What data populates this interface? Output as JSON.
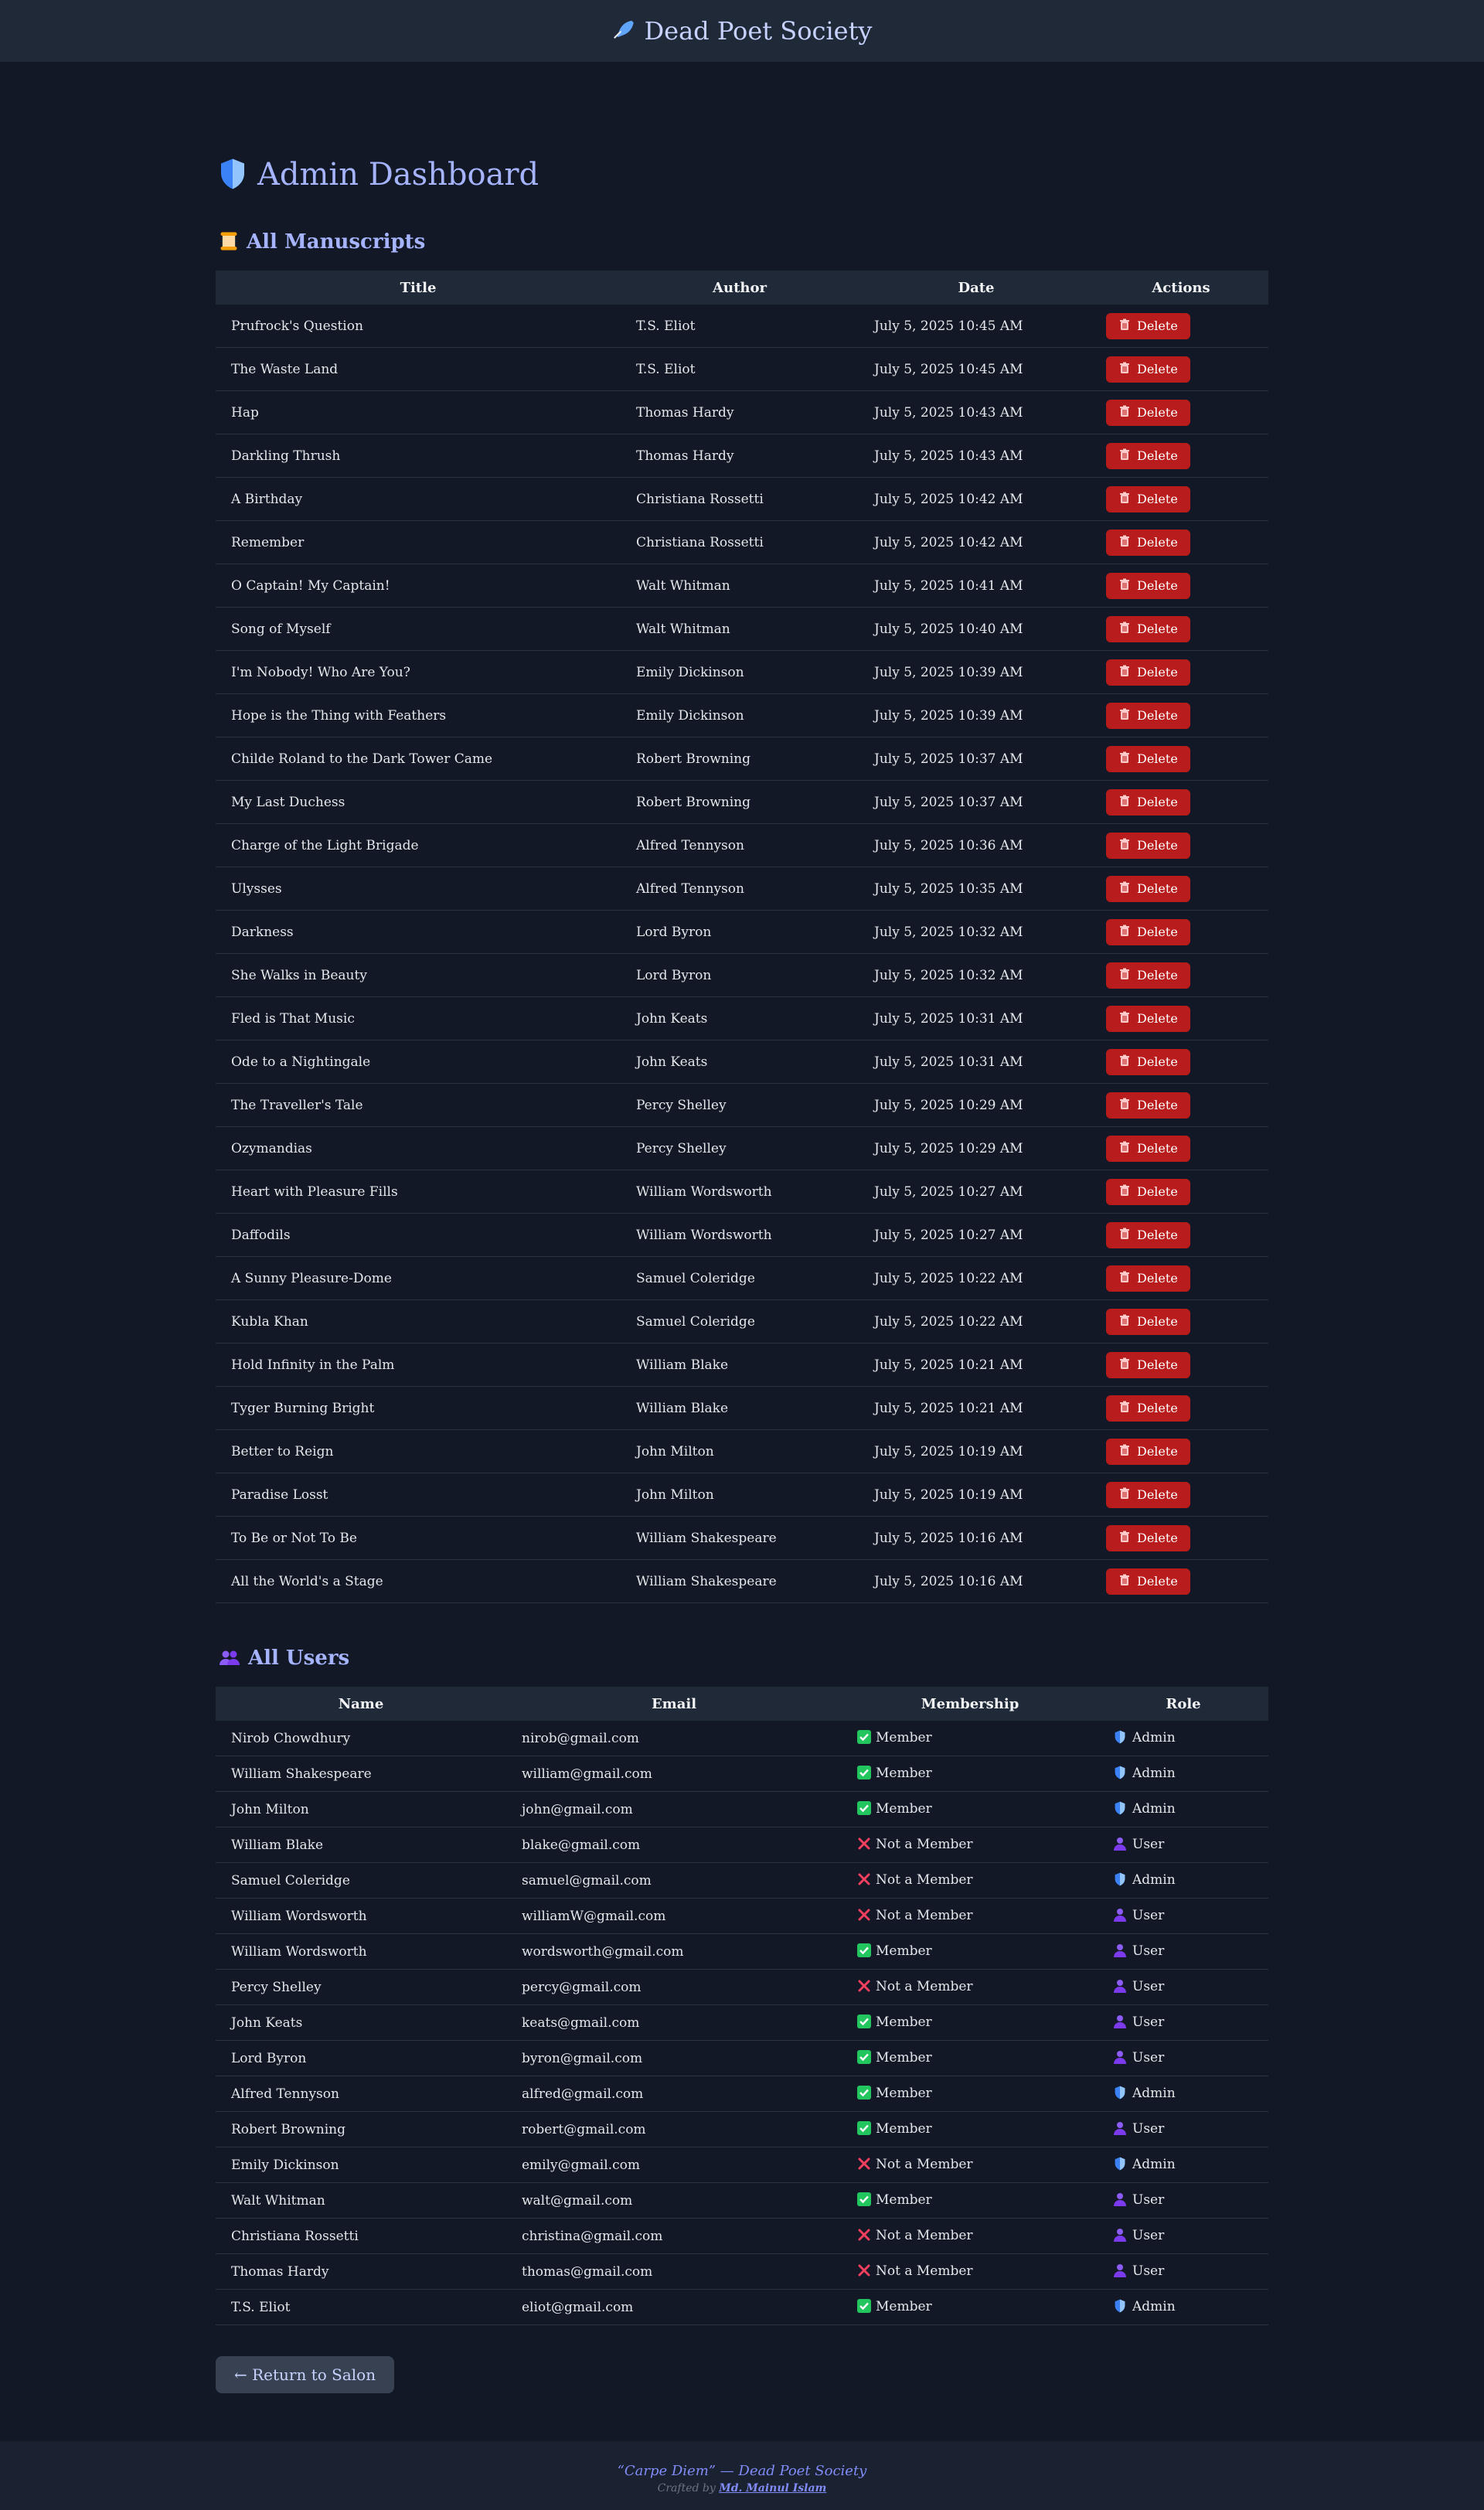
{
  "header": {
    "icon": "quill-icon",
    "site_title": "Dead Poet Society"
  },
  "page": {
    "icon": "shield-icon",
    "title": "Admin Dashboard"
  },
  "manuscripts": {
    "section_icon": "scroll-icon",
    "section_title": "All Manuscripts",
    "columns": [
      "Title",
      "Author",
      "Date",
      "Actions"
    ],
    "delete_label": "Delete",
    "rows": [
      {
        "title": "Prufrock's Question",
        "author": "T.S. Eliot",
        "date": "July 5, 2025 10:45 AM"
      },
      {
        "title": "The Waste Land",
        "author": "T.S. Eliot",
        "date": "July 5, 2025 10:45 AM"
      },
      {
        "title": "Hap",
        "author": "Thomas Hardy",
        "date": "July 5, 2025 10:43 AM"
      },
      {
        "title": "Darkling Thrush",
        "author": "Thomas Hardy",
        "date": "July 5, 2025 10:43 AM"
      },
      {
        "title": "A Birthday",
        "author": "Christiana Rossetti",
        "date": "July 5, 2025 10:42 AM"
      },
      {
        "title": "Remember",
        "author": "Christiana Rossetti",
        "date": "July 5, 2025 10:42 AM"
      },
      {
        "title": "O Captain! My Captain!",
        "author": "Walt Whitman",
        "date": "July 5, 2025 10:41 AM"
      },
      {
        "title": "Song of Myself",
        "author": "Walt Whitman",
        "date": "July 5, 2025 10:40 AM"
      },
      {
        "title": "I'm Nobody! Who Are You?",
        "author": "Emily Dickinson",
        "date": "July 5, 2025 10:39 AM"
      },
      {
        "title": "Hope is the Thing with Feathers",
        "author": "Emily Dickinson",
        "date": "July 5, 2025 10:39 AM"
      },
      {
        "title": "Childe Roland to the Dark Tower Came",
        "author": "Robert Browning",
        "date": "July 5, 2025 10:37 AM"
      },
      {
        "title": "My Last Duchess",
        "author": "Robert Browning",
        "date": "July 5, 2025 10:37 AM"
      },
      {
        "title": "Charge of the Light Brigade",
        "author": "Alfred Tennyson",
        "date": "July 5, 2025 10:36 AM"
      },
      {
        "title": "Ulysses",
        "author": "Alfred Tennyson",
        "date": "July 5, 2025 10:35 AM"
      },
      {
        "title": "Darkness",
        "author": "Lord Byron",
        "date": "July 5, 2025 10:32 AM"
      },
      {
        "title": "She Walks in Beauty",
        "author": "Lord Byron",
        "date": "July 5, 2025 10:32 AM"
      },
      {
        "title": "Fled is That Music",
        "author": "John Keats",
        "date": "July 5, 2025 10:31 AM"
      },
      {
        "title": "Ode to a Nightingale",
        "author": "John Keats",
        "date": "July 5, 2025 10:31 AM"
      },
      {
        "title": "The Traveller's Tale",
        "author": "Percy Shelley",
        "date": "July 5, 2025 10:29 AM"
      },
      {
        "title": "Ozymandias",
        "author": "Percy Shelley",
        "date": "July 5, 2025 10:29 AM"
      },
      {
        "title": "Heart with Pleasure Fills",
        "author": "William Wordsworth",
        "date": "July 5, 2025 10:27 AM"
      },
      {
        "title": "Daffodils",
        "author": "William Wordsworth",
        "date": "July 5, 2025 10:27 AM"
      },
      {
        "title": "A Sunny Pleasure-Dome",
        "author": "Samuel Coleridge",
        "date": "July 5, 2025 10:22 AM"
      },
      {
        "title": "Kubla Khan",
        "author": "Samuel Coleridge",
        "date": "July 5, 2025 10:22 AM"
      },
      {
        "title": "Hold Infinity in the Palm",
        "author": "William Blake",
        "date": "July 5, 2025 10:21 AM"
      },
      {
        "title": "Tyger Burning Bright",
        "author": "William Blake",
        "date": "July 5, 2025 10:21 AM"
      },
      {
        "title": "Better to Reign",
        "author": "John Milton",
        "date": "July 5, 2025 10:19 AM"
      },
      {
        "title": "Paradise Losst",
        "author": "John Milton",
        "date": "July 5, 2025 10:19 AM"
      },
      {
        "title": "To Be or Not To Be",
        "author": "William Shakespeare",
        "date": "July 5, 2025 10:16 AM"
      },
      {
        "title": "All the World's a Stage",
        "author": "William Shakespeare",
        "date": "July 5, 2025 10:16 AM"
      }
    ]
  },
  "users": {
    "section_icon": "users-icon",
    "section_title": "All Users",
    "columns": [
      "Name",
      "Email",
      "Membership",
      "Role"
    ],
    "rows": [
      {
        "name": "Nirob Chowdhury",
        "email": "nirob@gmail.com",
        "membership": "Member",
        "member": true,
        "role": "Admin"
      },
      {
        "name": "William Shakespeare",
        "email": "william@gmail.com",
        "membership": "Member",
        "member": true,
        "role": "Admin"
      },
      {
        "name": "John Milton",
        "email": "john@gmail.com",
        "membership": "Member",
        "member": true,
        "role": "Admin"
      },
      {
        "name": "William Blake",
        "email": "blake@gmail.com",
        "membership": "Not a Member",
        "member": false,
        "role": "User"
      },
      {
        "name": "Samuel Coleridge",
        "email": "samuel@gmail.com",
        "membership": "Not a Member",
        "member": false,
        "role": "Admin"
      },
      {
        "name": "William Wordsworth",
        "email": "williamW@gmail.com",
        "membership": "Not a Member",
        "member": false,
        "role": "User"
      },
      {
        "name": "William Wordsworth",
        "email": "wordsworth@gmail.com",
        "membership": "Member",
        "member": true,
        "role": "User"
      },
      {
        "name": "Percy Shelley",
        "email": "percy@gmail.com",
        "membership": "Not a Member",
        "member": false,
        "role": "User"
      },
      {
        "name": "John Keats",
        "email": "keats@gmail.com",
        "membership": "Member",
        "member": true,
        "role": "User"
      },
      {
        "name": "Lord Byron",
        "email": "byron@gmail.com",
        "membership": "Member",
        "member": true,
        "role": "User"
      },
      {
        "name": "Alfred Tennyson",
        "email": "alfred@gmail.com",
        "membership": "Member",
        "member": true,
        "role": "Admin"
      },
      {
        "name": "Robert Browning",
        "email": "robert@gmail.com",
        "membership": "Member",
        "member": true,
        "role": "User"
      },
      {
        "name": "Emily Dickinson",
        "email": "emily@gmail.com",
        "membership": "Not a Member",
        "member": false,
        "role": "Admin"
      },
      {
        "name": "Walt Whitman",
        "email": "walt@gmail.com",
        "membership": "Member",
        "member": true,
        "role": "User"
      },
      {
        "name": "Christiana Rossetti",
        "email": "christina@gmail.com",
        "membership": "Not a Member",
        "member": false,
        "role": "User"
      },
      {
        "name": "Thomas Hardy",
        "email": "thomas@gmail.com",
        "membership": "Not a Member",
        "member": false,
        "role": "User"
      },
      {
        "name": "T.S. Eliot",
        "email": "eliot@gmail.com",
        "membership": "Member",
        "member": true,
        "role": "Admin"
      }
    ]
  },
  "return_button": "← Return to Salon",
  "footer": {
    "quote": "“Carpe Diem” — Dead Poet Society",
    "crafted_prefix": "Crafted by",
    "author": "Md. Mainul Islam"
  },
  "colors": {
    "background": "#121826",
    "header_bg": "#1f2937",
    "accent": "#a5b4fc",
    "delete": "#b91c1c",
    "member_check": "#22c55e",
    "not_member_x": "#f43f5e"
  }
}
